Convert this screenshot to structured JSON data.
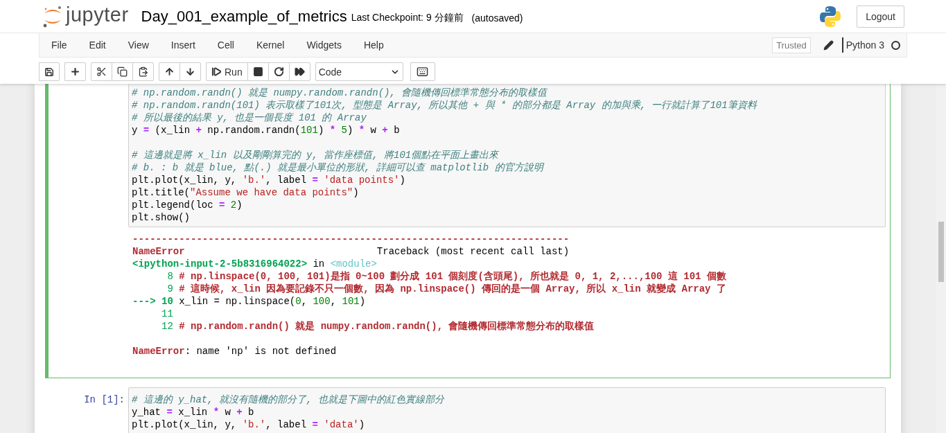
{
  "header": {
    "logo_text": "jupyter",
    "notebook_title": "Day_001_example_of_metrics",
    "checkpoint": "Last Checkpoint: 9 分鐘前",
    "autosave": "(autosaved)",
    "logout": "Logout"
  },
  "menubar": {
    "menus": [
      "File",
      "Edit",
      "View",
      "Insert",
      "Cell",
      "Kernel",
      "Widgets",
      "Help"
    ],
    "trusted": "Trusted",
    "kernel_name": "Python 3",
    "kernel_busy": false
  },
  "toolbar": {
    "run_label": "Run",
    "cell_type": "Code"
  },
  "cells": [
    {
      "selected": true,
      "input": [
        {
          "kind": "code",
          "tokens": [
            {
              "kind": "comment",
              "text": "# np.random.randn() 就是 numpy.random.randn(), 會隨機傳回標準常態分布的取樣值"
            }
          ]
        },
        {
          "kind": "code",
          "tokens": [
            {
              "kind": "comment",
              "text": "# np.random.randn(101) 表示取樣了101次, 型態是 Array, 所以其他 + 與 * 的部分都是 Array 的加與乘, 一行就計算了101筆資料"
            }
          ]
        },
        {
          "kind": "code",
          "tokens": [
            {
              "kind": "comment",
              "text": "# 所以最後的結果 y, 也是一個長度 101 的 Array"
            }
          ]
        },
        {
          "kind": "code",
          "tokens": [
            {
              "kind": "plain",
              "text": "y "
            },
            {
              "kind": "operator",
              "text": "="
            },
            {
              "kind": "plain",
              "text": " (x_lin "
            },
            {
              "kind": "operator",
              "text": "+"
            },
            {
              "kind": "plain",
              "text": " np.random.randn("
            },
            {
              "kind": "number",
              "text": "101"
            },
            {
              "kind": "plain",
              "text": ") "
            },
            {
              "kind": "operator",
              "text": "*"
            },
            {
              "kind": "number",
              "text": " 5"
            },
            {
              "kind": "plain",
              "text": ") "
            },
            {
              "kind": "operator",
              "text": "*"
            },
            {
              "kind": "plain",
              "text": " w "
            },
            {
              "kind": "operator",
              "text": "+"
            },
            {
              "kind": "plain",
              "text": " b"
            }
          ]
        },
        {
          "kind": "blank"
        },
        {
          "kind": "code",
          "tokens": [
            {
              "kind": "comment",
              "text": "# 這邊就是將 x_lin 以及剛剛算完的 y, 當作座標值, 將101個點在平面上畫出來"
            }
          ]
        },
        {
          "kind": "code",
          "tokens": [
            {
              "kind": "comment",
              "text": "# b. : b 就是 blue, 點(.) 就是最小單位的形狀, 詳細可以查 matplotlib 的官方說明"
            }
          ]
        },
        {
          "kind": "code",
          "tokens": [
            {
              "kind": "plain",
              "text": "plt.plot(x_lin, y, "
            },
            {
              "kind": "string",
              "text": "'b.'"
            },
            {
              "kind": "plain",
              "text": ", label "
            },
            {
              "kind": "operator",
              "text": "="
            },
            {
              "kind": "string",
              "text": " 'data points'"
            },
            {
              "kind": "plain",
              "text": ")"
            }
          ]
        },
        {
          "kind": "code",
          "tokens": [
            {
              "kind": "plain",
              "text": "plt.title("
            },
            {
              "kind": "string",
              "text": "\"Assume we have data points\""
            },
            {
              "kind": "plain",
              "text": ")"
            }
          ]
        },
        {
          "kind": "code",
          "tokens": [
            {
              "kind": "plain",
              "text": "plt.legend(loc "
            },
            {
              "kind": "operator",
              "text": "="
            },
            {
              "kind": "number",
              "text": " 2"
            },
            {
              "kind": "plain",
              "text": ")"
            }
          ]
        },
        {
          "kind": "code",
          "tokens": [
            {
              "kind": "plain",
              "text": "plt.show()"
            }
          ]
        }
      ],
      "output": [
        {
          "kind": "code",
          "tokens": [
            {
              "kind": "error",
              "text": "---------------------------------------------------------------------------"
            }
          ]
        },
        {
          "kind": "code",
          "tokens": [
            {
              "kind": "error",
              "text": "NameError"
            },
            {
              "kind": "plain",
              "text": "                                 Traceback (most recent call last)"
            }
          ]
        },
        {
          "kind": "code",
          "tokens": [
            {
              "kind": "path",
              "text": "<ipython-input-2-5b8316964022>"
            },
            {
              "kind": "plain",
              "text": " in "
            },
            {
              "kind": "module",
              "text": "<module>"
            }
          ]
        },
        {
          "kind": "code",
          "tokens": [
            {
              "kind": "lineno",
              "text": "      8 "
            },
            {
              "kind": "error",
              "text": "# np.linspace(0, 100, 101)是指 0~100 劃分成 101 個刻度(含頭尾), 所也就是 0, 1, 2,...,100 這 101 個數"
            }
          ]
        },
        {
          "kind": "code",
          "tokens": [
            {
              "kind": "lineno",
              "text": "      9 "
            },
            {
              "kind": "error",
              "text": "# 這時候, x_lin 因為要記錄不只一個數, 因為 np.linspace() 傳回的是一個 Array, 所以 x_lin 就變成 Array 了"
            }
          ]
        },
        {
          "kind": "code",
          "tokens": [
            {
              "kind": "path",
              "text": "---> 10"
            },
            {
              "kind": "plain",
              "text": " x_lin = np.linspace("
            },
            {
              "kind": "num_out",
              "text": "0"
            },
            {
              "kind": "plain",
              "text": ", "
            },
            {
              "kind": "num_out",
              "text": "100"
            },
            {
              "kind": "plain",
              "text": ", "
            },
            {
              "kind": "num_out",
              "text": "101"
            },
            {
              "kind": "plain",
              "text": ")"
            }
          ]
        },
        {
          "kind": "code",
          "tokens": [
            {
              "kind": "lineno",
              "text": "     11"
            }
          ]
        },
        {
          "kind": "code",
          "tokens": [
            {
              "kind": "lineno",
              "text": "     12 "
            },
            {
              "kind": "error",
              "text": "# np.random.randn() 就是 numpy.random.randn(), 會隨機傳回標準常態分布的取樣值"
            }
          ]
        },
        {
          "kind": "blank"
        },
        {
          "kind": "code",
          "tokens": [
            {
              "kind": "error",
              "text": "NameError"
            },
            {
              "kind": "plain",
              "text": ": name 'np' is not defined"
            }
          ]
        }
      ]
    },
    {
      "selected": false,
      "prompt": "In [1]:",
      "input": [
        {
          "kind": "code",
          "tokens": [
            {
              "kind": "comment",
              "text": "# 這邊的 y_hat, 就沒有隨機的部分了, 也就是下圖中的紅色實線部分"
            }
          ]
        },
        {
          "kind": "code",
          "tokens": [
            {
              "kind": "plain",
              "text": "y_hat "
            },
            {
              "kind": "operator",
              "text": "="
            },
            {
              "kind": "plain",
              "text": " x_lin "
            },
            {
              "kind": "operator",
              "text": "*"
            },
            {
              "kind": "plain",
              "text": " w "
            },
            {
              "kind": "operator",
              "text": "+"
            },
            {
              "kind": "plain",
              "text": " b"
            }
          ]
        },
        {
          "kind": "code",
          "tokens": [
            {
              "kind": "plain",
              "text": "plt.plot(x_lin, y, "
            },
            {
              "kind": "string",
              "text": "'b.'"
            },
            {
              "kind": "plain",
              "text": ", label "
            },
            {
              "kind": "operator",
              "text": "="
            },
            {
              "kind": "string",
              "text": " 'data'"
            },
            {
              "kind": "plain",
              "text": ")"
            }
          ]
        }
      ]
    }
  ]
}
